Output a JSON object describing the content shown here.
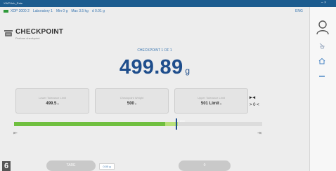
{
  "window": {
    "title": "XWPHub_Rate",
    "controls": "–  ×"
  },
  "status_bar": {
    "device": "XDP 3000 2",
    "laboratory": "Laboratory 1",
    "min": "Min 0 g",
    "max": "Max 3.5 kg",
    "d": "d 0.01 g",
    "language": "ENG"
  },
  "app": {
    "title": "CHECKPOINT",
    "subtitle": "Perform checkpoint",
    "icon": "balance-scale-icon"
  },
  "checkpoint": {
    "label": "CHECKPOINT 1 OF 1",
    "weight_value": "499.89",
    "weight_unit": "g"
  },
  "cards": {
    "lower": {
      "label": "Lower Tolerance Limit",
      "value": "499.5",
      "unit": "g"
    },
    "target": {
      "label": "Checkpoint Weight",
      "value": "500",
      "unit": "g"
    },
    "upper": {
      "label": "Upper Tolerance Limit",
      "value": "501 Limit",
      "unit": "g"
    }
  },
  "indicators": {
    "tolerance_symbol": "▸◂",
    "range_symbol": "> 0 <"
  },
  "progress": {
    "fraction": 0.66,
    "light_start": 0.61,
    "marker_label": "500",
    "left_mark": "⇤",
    "right_mark": "⇥"
  },
  "buttons": {
    "tare_label": "TARE",
    "tare_value": "0.00 g",
    "zero_label": "0"
  },
  "figure_number": "6",
  "sidebar": {
    "icons": [
      "user-icon",
      "clean-icon",
      "home-icon",
      "menu-icon"
    ]
  },
  "colors": {
    "title_bar": "#1c5c8f",
    "accent": "#1f4e8c",
    "progress_green": "#6fbf3f",
    "status_green": "#2f9a3a"
  }
}
